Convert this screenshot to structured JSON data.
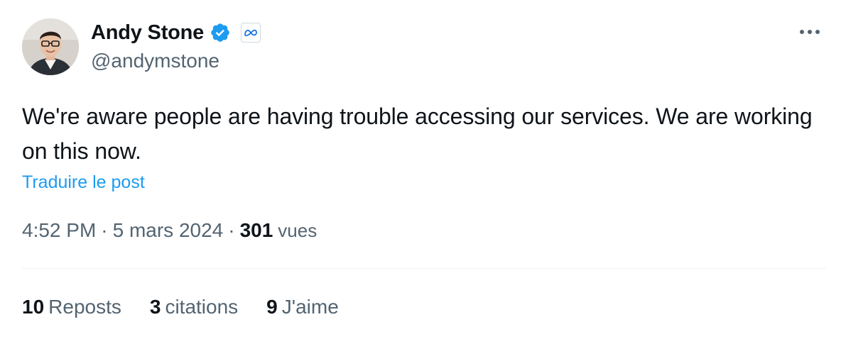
{
  "author": {
    "display_name": "Andy Stone",
    "handle": "@andymstone",
    "verified_icon": "verified-badge-icon",
    "affiliate_icon": "meta-logo-icon"
  },
  "tweet": {
    "text": "We're aware people are having trouble accessing our services. We are working on this now.",
    "translate_label": "Traduire le post",
    "time": "4:52 PM",
    "separator": "·",
    "date": "5 mars 2024",
    "views_count": "301",
    "views_label": "vues"
  },
  "stats": [
    {
      "count": "10",
      "label": "Reposts"
    },
    {
      "count": "3",
      "label": "citations"
    },
    {
      "count": "9",
      "label": "J'aime"
    }
  ],
  "colors": {
    "accent": "#1d9bf0",
    "text_primary": "#0f1419",
    "text_secondary": "#536471",
    "divider": "#eff3f4"
  }
}
